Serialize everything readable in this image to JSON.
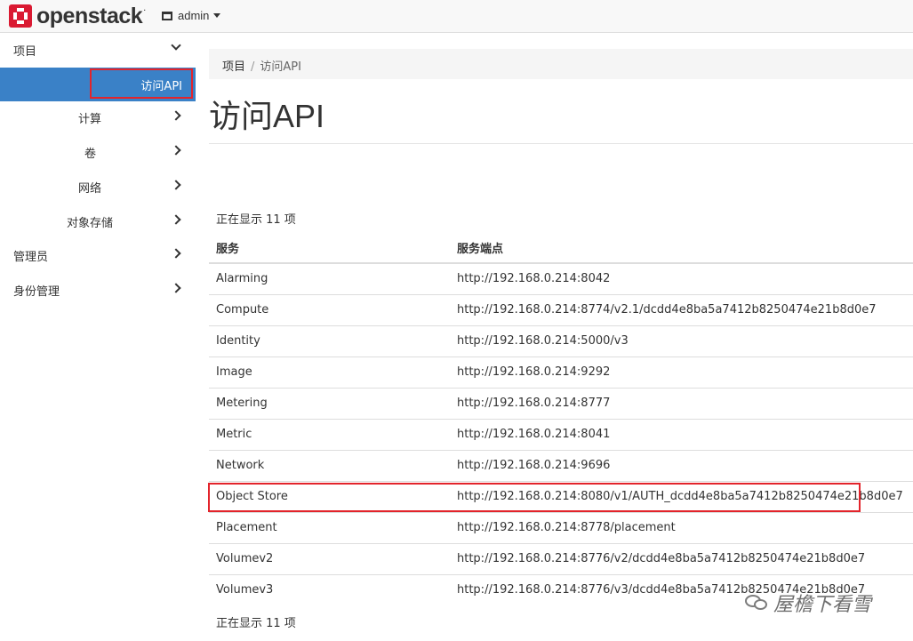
{
  "header": {
    "brand": "openstack",
    "brand_mark": ".",
    "user_menu": "admin"
  },
  "sidebar": {
    "items": [
      {
        "label": "项目",
        "chevron": "down"
      },
      {
        "label": "访问API",
        "active": true
      },
      {
        "label": "计算",
        "chevron": "right"
      },
      {
        "label": "卷",
        "chevron": "right"
      },
      {
        "label": "网络",
        "chevron": "right"
      },
      {
        "label": "对象存储",
        "chevron": "right"
      },
      {
        "label": "管理员",
        "chevron": "right"
      },
      {
        "label": "身份管理",
        "chevron": "right"
      }
    ]
  },
  "breadcrumb": {
    "root": "项目",
    "separator": "/",
    "current": "访问API"
  },
  "page": {
    "title": "访问API",
    "count_text": "正在显示 11 项"
  },
  "table": {
    "headers": [
      "服务",
      "服务端点"
    ],
    "rows": [
      [
        "Alarming",
        "http://192.168.0.214:8042"
      ],
      [
        "Compute",
        "http://192.168.0.214:8774/v2.1/dcdd4e8ba5a7412b8250474e21b8d0e7"
      ],
      [
        "Identity",
        "http://192.168.0.214:5000/v3"
      ],
      [
        "Image",
        "http://192.168.0.214:9292"
      ],
      [
        "Metering",
        "http://192.168.0.214:8777"
      ],
      [
        "Metric",
        "http://192.168.0.214:8041"
      ],
      [
        "Network",
        "http://192.168.0.214:9696"
      ],
      [
        "Object Store",
        "http://192.168.0.214:8080/v1/AUTH_dcdd4e8ba5a7412b8250474e21b8d0e7"
      ],
      [
        "Placement",
        "http://192.168.0.214:8778/placement"
      ],
      [
        "Volumev2",
        "http://192.168.0.214:8776/v2/dcdd4e8ba5a7412b8250474e21b8d0e7"
      ],
      [
        "Volumev3",
        "http://192.168.0.214:8776/v3/dcdd4e8ba5a7412b8250474e21b8d0e7"
      ]
    ]
  },
  "watermark": {
    "text": "屋檐下看雪"
  },
  "colors": {
    "active_nav": "#3a81c7",
    "highlight_border": "#e3242b",
    "brand_red": "#da1a32"
  }
}
